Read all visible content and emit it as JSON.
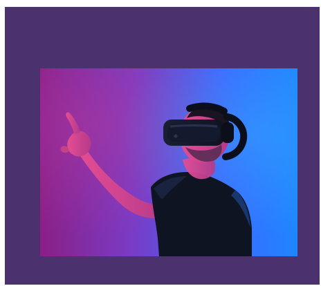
{
  "image": {
    "subject": "vr-user-pointing",
    "background_color": "#4b326e",
    "photo_colors": {
      "left": "#8a1f86",
      "mid": "#7a3bc4",
      "right": "#1e86ff",
      "shirt": "#0e1422",
      "skin_lit": "#d64a86",
      "headset": "#0f1320"
    }
  }
}
